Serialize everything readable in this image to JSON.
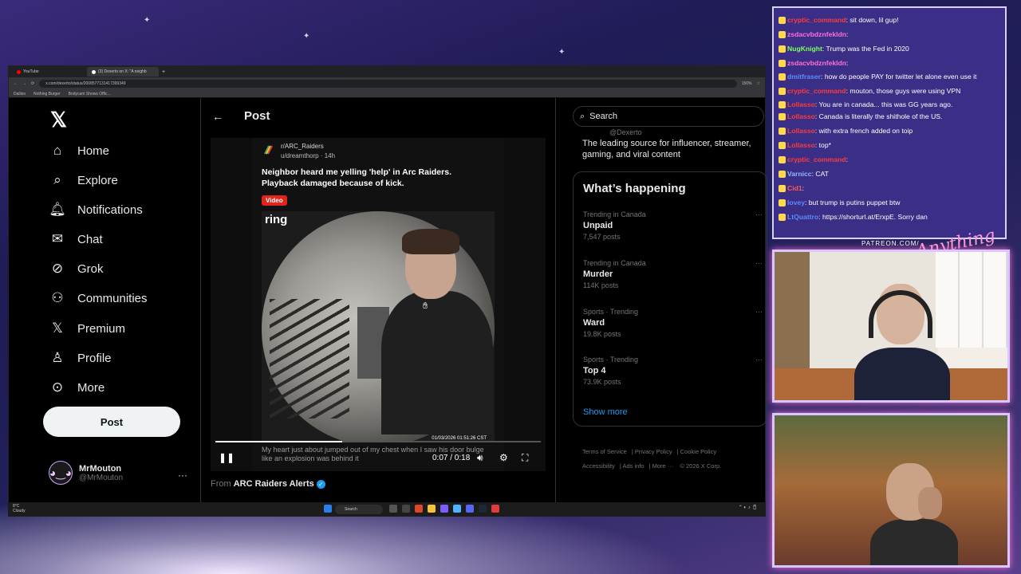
{
  "browser": {
    "tabs": [
      {
        "label": "YouTube",
        "active": false
      },
      {
        "label": "(3) Dexerto on X: \"A neighb",
        "active": true
      }
    ],
    "url": "x.com/dexerto/status/2008577131417399349",
    "zoom": "150%",
    "bookmarks": [
      "Dailies",
      "Nothing Burger",
      "Bodycam Shows Offic..."
    ]
  },
  "nav": {
    "items": [
      {
        "label": "Home",
        "icon": "home-icon"
      },
      {
        "label": "Explore",
        "icon": "search-icon"
      },
      {
        "label": "Notifications",
        "icon": "bell-icon"
      },
      {
        "label": "Chat",
        "icon": "mail-icon"
      },
      {
        "label": "Grok",
        "icon": "grok-icon"
      },
      {
        "label": "Communities",
        "icon": "people-icon"
      },
      {
        "label": "Premium",
        "icon": "x-icon"
      },
      {
        "label": "Profile",
        "icon": "person-icon"
      },
      {
        "label": "More",
        "icon": "more-icon"
      }
    ],
    "post_label": "Post",
    "user": {
      "name": "MrMouton",
      "handle": "@MrMouton"
    }
  },
  "post": {
    "header_title": "Post",
    "subreddit": "r/ARC_Raiders",
    "reddit_user": "u/dreamthorp",
    "age": "14h",
    "reddit_title": "Neighbor heard me yelling 'help' in Arc Raiders. Playback damaged because of kick.",
    "badge": "Video",
    "ring_logo": "ring",
    "timestamp_overlay": "01/03/2026 01:51:26 CST",
    "caption": "My heart just about jumped out of my chest when I saw his door bulge like an explosion was behind it",
    "time": "0:07 / 0:18",
    "progress": 0.39,
    "from_label": "From",
    "from_account": "ARC Raiders Alerts"
  },
  "right": {
    "search_placeholder": "Search",
    "promo_handle": "@Dexerto",
    "promo_text": "The leading source for influencer, streamer, gaming, and viral content",
    "happening_title": "What’s happening",
    "trends": [
      {
        "category": "Trending in Canada",
        "name": "Unpaid",
        "posts": "7,547 posts"
      },
      {
        "category": "Trending in Canada",
        "name": "Murder",
        "posts": "114K posts"
      },
      {
        "category": "Sports · Trending",
        "name": "Ward",
        "posts": "19.8K posts"
      },
      {
        "category": "Sports · Trending",
        "name": "Top 4",
        "posts": "73.9K posts"
      }
    ],
    "show_more": "Show more",
    "footer": [
      "Terms of Service",
      "Privacy Policy",
      "Cookie Policy",
      "Accessibility",
      "Ads info",
      "More ···",
      "© 2026 X Corp."
    ]
  },
  "taskbar": {
    "weather_temp": "8°C",
    "weather_desc": "Cloudy",
    "search": "Search"
  },
  "chat": {
    "messages": [
      {
        "user": "cryptic_command",
        "color": "#ff3b3b",
        "text": "sit down, lil gup!"
      },
      {
        "user": "zsdacvbdznfekldn",
        "color": "#ff6fd8",
        "text": ""
      },
      {
        "user": "NugKnight",
        "color": "#7dff5a",
        "text": "Trump was the Fed in 2020"
      },
      {
        "user": "zsdacvbdznfekldn",
        "color": "#ff6fd8",
        "text": ""
      },
      {
        "user": "dmitfraser",
        "color": "#5a8cff",
        "text": "how do people PAY for twitter let alone even use it"
      },
      {
        "user": "cryptic_command",
        "color": "#ff3b3b",
        "text": "mouton, those guys were using VPN"
      },
      {
        "user": "Lollasso",
        "color": "#ff3b3b",
        "text": "You are in canada... this was GG years ago."
      },
      {
        "user": "Lollasso",
        "color": "#ff3b3b",
        "text": "Canada is literally the shithole of the US."
      },
      {
        "user": "Lollasso",
        "color": "#ff3b3b",
        "text": "with extra french added on toip"
      },
      {
        "user": "Lollasso",
        "color": "#ff3b3b",
        "text": "top*"
      },
      {
        "user": "cryptic_command",
        "color": "#ff3b3b",
        "text": ""
      },
      {
        "user": "Varnicc",
        "color": "#8fb8ff",
        "text": "CAT"
      },
      {
        "user": "Cid1",
        "color": "#ff5a5a",
        "text": ""
      },
      {
        "user": "lovey",
        "color": "#5a8cff",
        "text": "but trump is putins puppet btw"
      },
      {
        "user": "LtQuattro",
        "color": "#5a8cff",
        "text": "https://shorturl.at/ErxpE. Sorry dan"
      }
    ],
    "patreon": "PATREON.COM/",
    "signature": "Anything Else?"
  }
}
